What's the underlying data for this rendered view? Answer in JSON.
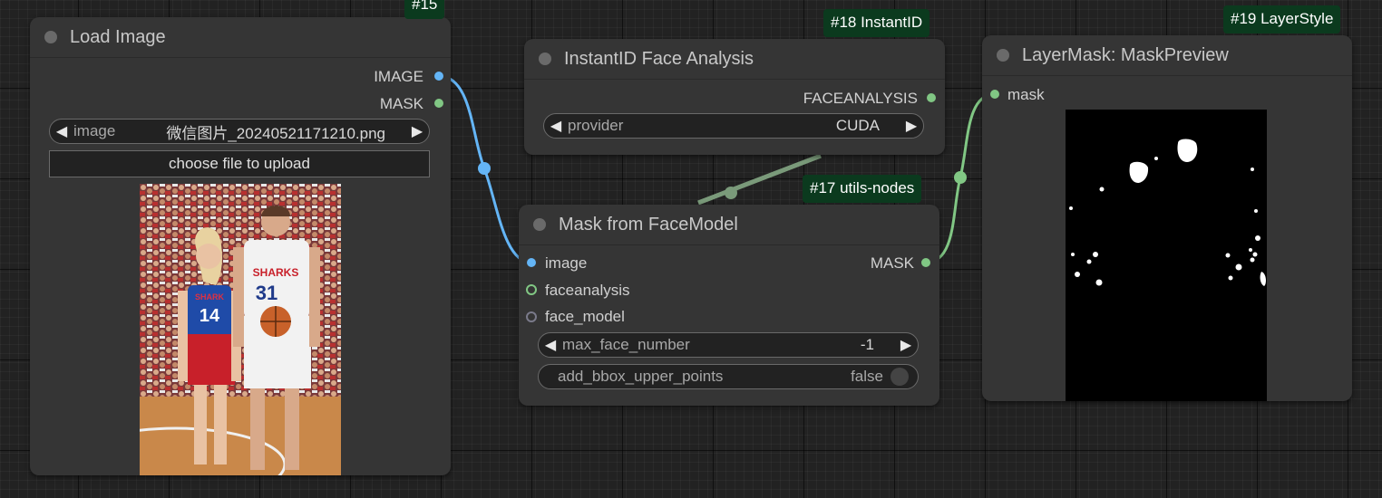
{
  "nodes": {
    "load_image": {
      "badge": "#15",
      "title": "Load Image",
      "outputs": [
        "IMAGE",
        "MASK"
      ],
      "image_widget": {
        "name": "image",
        "value": "微信图片_20240521171210.png"
      },
      "upload_label": "choose file to upload",
      "preview": {
        "jersey_left_text": "SHARK",
        "jersey_left_number": "14",
        "jersey_right_text": "SHARKS",
        "jersey_right_number": "31"
      }
    },
    "face_analysis": {
      "badge": "#18 InstantID",
      "title": "InstantID Face Analysis",
      "output": "FACEANALYSIS",
      "provider_widget": {
        "name": "provider",
        "value": "CUDA"
      }
    },
    "mask_from_face": {
      "badge": "#17 utils-nodes",
      "title": "Mask from FaceModel",
      "inputs": [
        "image",
        "faceanalysis",
        "face_model"
      ],
      "output": "MASK",
      "max_face_widget": {
        "name": "max_face_number",
        "value": "-1"
      },
      "bbox_widget": {
        "name": "add_bbox_upper_points",
        "value": "false"
      }
    },
    "mask_preview": {
      "badge": "#19 LayerStyle",
      "title": "LayerMask: MaskPreview",
      "input": "mask"
    }
  },
  "colors": {
    "image_slot": "#64b5f6",
    "mask_slot": "#81c784",
    "canvas_bg": "#222222",
    "node_bg": "#353535",
    "badge_bg": "#0b3a1e"
  }
}
